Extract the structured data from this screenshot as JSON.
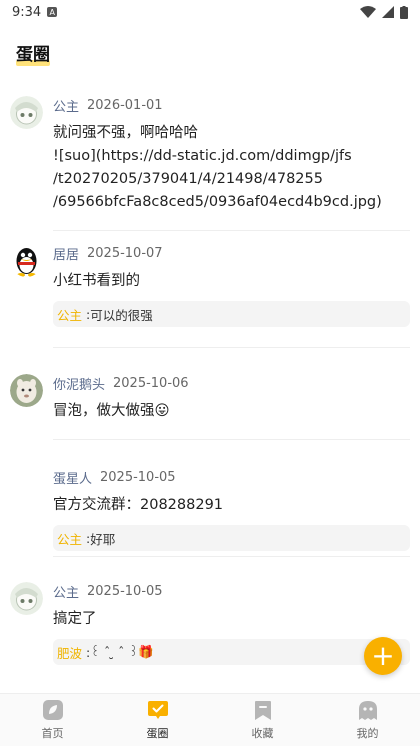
{
  "status": {
    "time": "9:34",
    "notif": "A"
  },
  "page": {
    "title": "蛋圈"
  },
  "posts": [
    {
      "name": "公主",
      "date": "2026-01-01",
      "content": "就问强不强，啊哈哈哈\n![suo](https://dd-static.jd.com/ddimgp/jfs\n/t20270205/379041/4/21498/478255\n/69566bfcFa8c8ced5/0936af04ecd4b9cd.jpg)"
    },
    {
      "name": "居居",
      "date": "2025-10-07",
      "content": "小红书看到的",
      "reply": {
        "name": "公主",
        "sep": " : ",
        "text": "可以的很强"
      }
    },
    {
      "name": "你泥鹅头",
      "date": "2025-10-06",
      "content": "冒泡，做大做强😛"
    },
    {
      "name": "蛋星人",
      "date": "2025-10-05",
      "content": "官方交流群：208288291",
      "reply": {
        "name": "公主",
        "sep": " : ",
        "text": "好耶"
      }
    },
    {
      "name": "公主",
      "date": "2025-10-05",
      "content": "搞定了",
      "reply": {
        "name": "肥波",
        "sep": " : ",
        "text": "꒰ ˆ ̮ ˆ ꒱🎁"
      }
    }
  ],
  "fab": {
    "label": "+"
  },
  "tabs": [
    {
      "label": "首页",
      "icon": "leaf-icon"
    },
    {
      "label": "蛋圈",
      "icon": "chat-check-icon",
      "active": true
    },
    {
      "label": "收藏",
      "icon": "bookmark-icon"
    },
    {
      "label": "我的",
      "icon": "ghost-icon"
    }
  ],
  "colors": {
    "accent": "#f9b000",
    "name": "#5b6b8c",
    "reply_name": "#f0b400"
  }
}
